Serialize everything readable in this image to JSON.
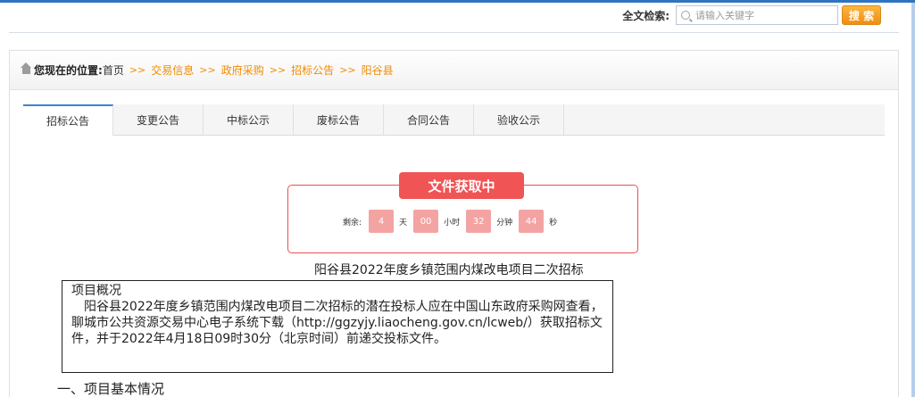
{
  "header": {
    "search_label": "全文检索:",
    "search_placeholder": "请输入关键字",
    "search_button": "搜 索"
  },
  "breadcrumb": {
    "label": "您现在的位置:",
    "home": "首页",
    "separator": ">>",
    "items": [
      "交易信息",
      "政府采购",
      "招标公告",
      "阳谷县"
    ]
  },
  "tabs": [
    {
      "label": "招标公告",
      "active": true
    },
    {
      "label": "变更公告",
      "active": false
    },
    {
      "label": "中标公示",
      "active": false
    },
    {
      "label": "废标公告",
      "active": false
    },
    {
      "label": "合同公告",
      "active": false
    },
    {
      "label": "验收公示",
      "active": false
    }
  ],
  "countdown": {
    "title": "文件获取中",
    "prefix": "剩余:",
    "days": "4",
    "days_unit": "天",
    "hours": "00",
    "hours_unit": "小时",
    "minutes": "32",
    "minutes_unit": "分钟",
    "seconds": "44",
    "seconds_unit": "秒"
  },
  "document": {
    "title": "阳谷县2022年度乡镇范围内煤改电项目二次招标",
    "overview_heading": "项目概况",
    "overview_text": "　阳谷县2022年度乡镇范围内煤改电项目二次招标的潜在投标人应在中国山东政府采购网查看，聊城市公共资源交易中心电子系统下载（http://ggzyjy.liaocheng.gov.cn/lcweb/）获取招标文件，并于2022年4月18日09时30分（北京时间）前递交投标文件。",
    "section_one": "一、项目基本情况"
  },
  "colors": {
    "accent_blue": "#2f74c0",
    "breadcrumb_orange": "#f28b00",
    "countdown_red": "#f05454",
    "countdown_pink": "#f4a3a3",
    "search_button_orange": "#f08d12"
  }
}
